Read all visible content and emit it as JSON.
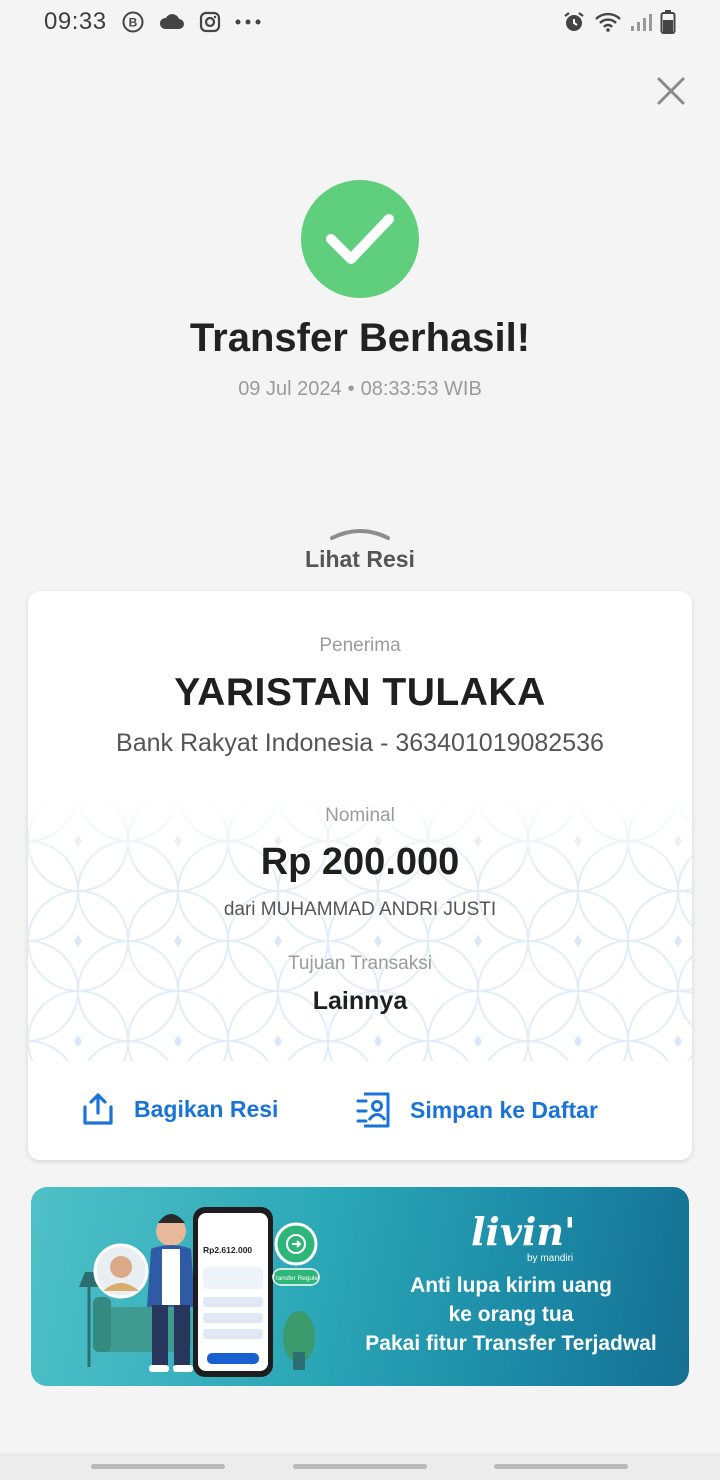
{
  "status_bar": {
    "time": "09:33",
    "left_icons": [
      "b-circle-icon",
      "cloud-icon",
      "instagram-icon",
      "more-icon"
    ],
    "right_icons": [
      "alarm-icon",
      "wifi-icon",
      "signal-icon",
      "battery-icon"
    ]
  },
  "header": {
    "close_icon": "close-icon"
  },
  "success": {
    "icon": "checkmark-icon",
    "icon_color": "#5fcf7d",
    "title": "Transfer Berhasil!",
    "date": "09 Jul 2024",
    "separator": "•",
    "time": "08:33:53 WIB"
  },
  "receipt_toggle": {
    "label": "Lihat Resi"
  },
  "receipt": {
    "recipient_label": "Penerima",
    "recipient_name": "YARISTAN TULAKA",
    "recipient_bank": "Bank Rakyat Indonesia - 363401019082536",
    "amount_label": "Nominal",
    "amount": "Rp 200.000",
    "from": "dari MUHAMMAD ANDRI JUSTI",
    "purpose_label": "Tujuan Transaksi",
    "purpose": "Lainnya",
    "actions": {
      "share_label": "Bagikan Resi",
      "save_label": "Simpan ke Daftar"
    },
    "accent_color": "#1a73d9"
  },
  "promo": {
    "brand": "livin'",
    "brand_sub": "by mandiri",
    "line1": "Anti lupa kirim uang",
    "line2": "ke orang tua",
    "line3": "Pakai fitur Transfer Terjadwal",
    "phone_amount": "Rp2.612.000",
    "phone_bubble": "Transfer Reguler"
  }
}
